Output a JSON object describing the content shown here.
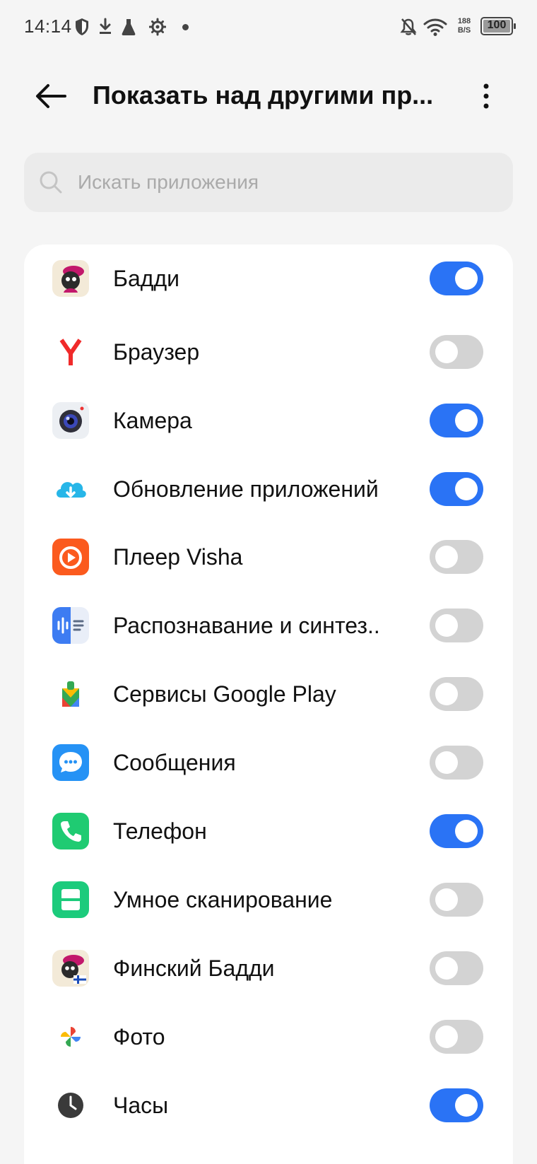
{
  "status_bar": {
    "time": "14:14",
    "net_speed_value": "188",
    "net_speed_unit": "B/S",
    "battery": "100",
    "icons": [
      "shield-icon",
      "download-icon",
      "flask-icon",
      "gear-icon",
      "dot-icon",
      "bell-off-icon",
      "wifi-icon"
    ]
  },
  "header": {
    "title": "Показать над другими пр...",
    "back_icon": "arrow-left-icon",
    "more_icon": "more-vert-icon"
  },
  "search": {
    "placeholder": "Искать приложения",
    "value": ""
  },
  "colors": {
    "accent": "#2a73f5",
    "toggle_off": "#d3d3d3",
    "background": "#f5f5f5",
    "card": "#ffffff"
  },
  "apps": [
    {
      "label": "Бадди",
      "enabled": true,
      "icon": "buddy-icon"
    },
    {
      "label": "Браузер",
      "enabled": false,
      "icon": "yandex-browser-icon"
    },
    {
      "label": "Камера",
      "enabled": true,
      "icon": "camera-icon"
    },
    {
      "label": "Обновление приложений",
      "enabled": true,
      "icon": "app-update-icon"
    },
    {
      "label": "Плеер Visha",
      "enabled": false,
      "icon": "visha-player-icon"
    },
    {
      "label": "Распознавание и синтез..",
      "enabled": false,
      "icon": "speech-recognition-icon"
    },
    {
      "label": "Сервисы Google Play",
      "enabled": false,
      "icon": "google-play-services-icon"
    },
    {
      "label": "Сообщения",
      "enabled": false,
      "icon": "messages-icon"
    },
    {
      "label": "Телефон",
      "enabled": true,
      "icon": "phone-icon"
    },
    {
      "label": "Умное сканирование",
      "enabled": false,
      "icon": "smart-scan-icon"
    },
    {
      "label": "Финский Бадди",
      "enabled": false,
      "icon": "finnish-buddy-icon"
    },
    {
      "label": "Фото",
      "enabled": false,
      "icon": "photos-icon"
    },
    {
      "label": "Часы",
      "enabled": true,
      "icon": "clock-icon"
    }
  ]
}
